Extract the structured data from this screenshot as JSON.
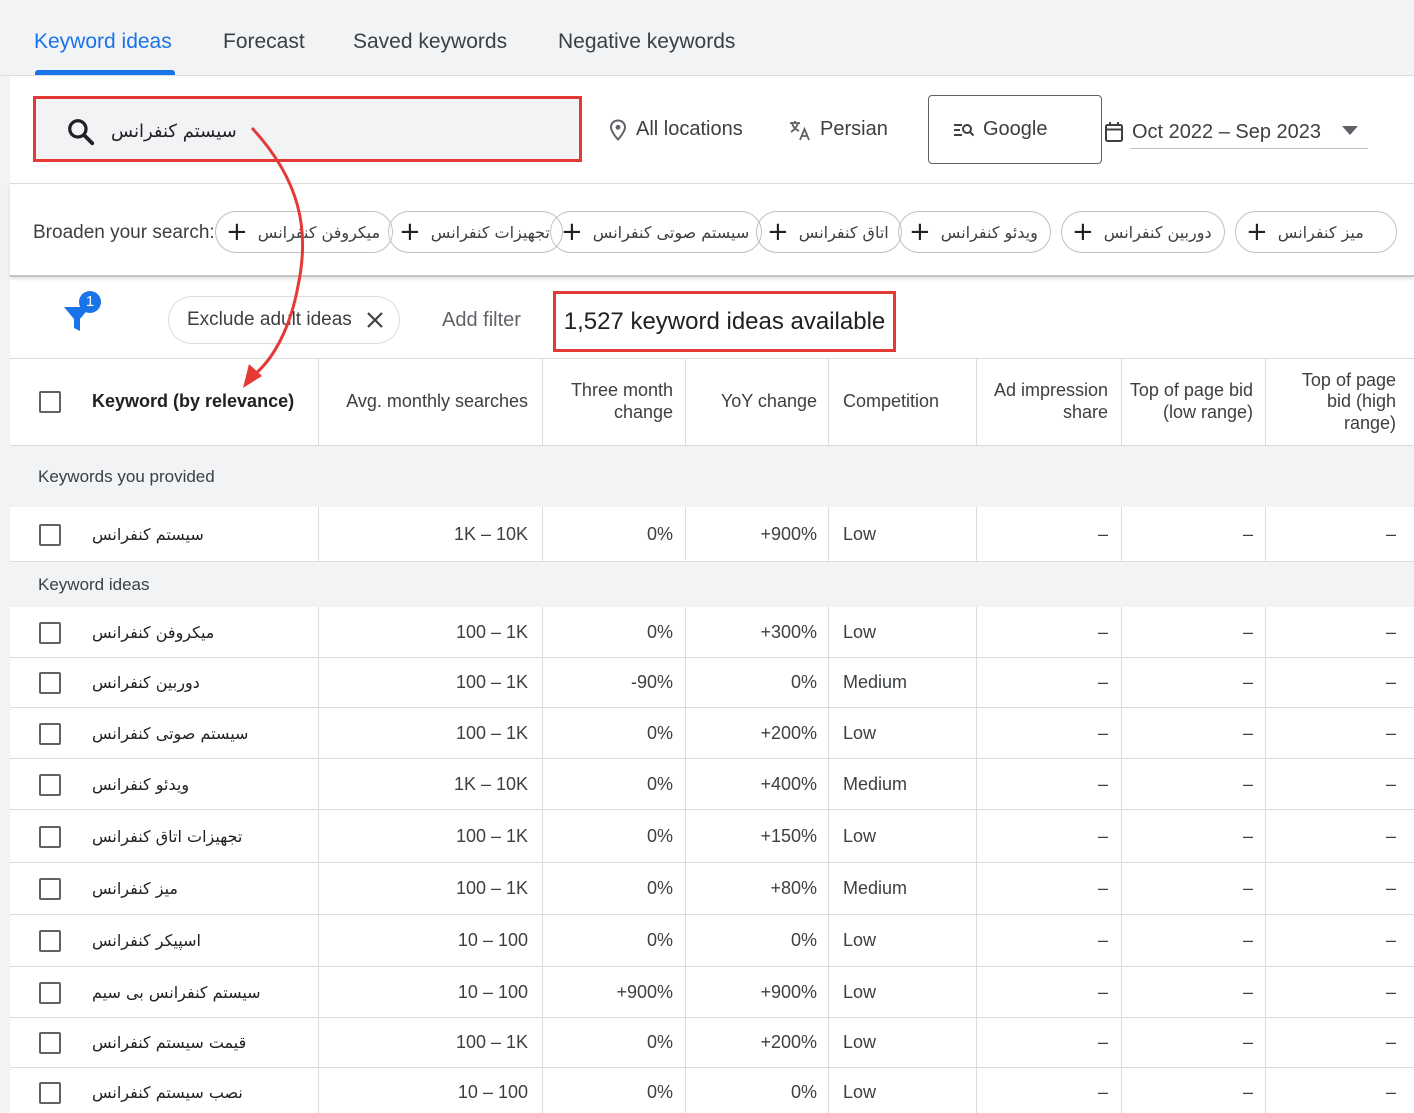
{
  "tabs": [
    {
      "label": "Keyword ideas",
      "active": true
    },
    {
      "label": "Forecast",
      "active": false
    },
    {
      "label": "Saved keywords",
      "active": false
    },
    {
      "label": "Negative keywords",
      "active": false
    }
  ],
  "search": {
    "value": "سیستم کنفرانس",
    "icon": "search-icon"
  },
  "options": {
    "location": "All locations",
    "language": "Persian",
    "network": "Google",
    "date_range": "Oct 2022 – Sep 2023"
  },
  "broaden": {
    "label": "Broaden your search:",
    "chips": [
      "میکروفن کنفرانس",
      "تجهیزات کنفرانس",
      "سیستم صوتی کنفرانس",
      "اتاق کنفرانس",
      "ویدئو کنفرانس",
      "دوربین کنفرانس",
      "میز کنفرانس"
    ]
  },
  "filters": {
    "badge_count": "1",
    "exclude_label": "Exclude adult ideas",
    "add_filter": "Add filter",
    "count_text": "1,527 keyword ideas available"
  },
  "columns": {
    "keyword": "Keyword (by relevance)",
    "avg": "Avg. monthly searches",
    "three_month": "Three month change",
    "yoy": "YoY change",
    "competition": "Competition",
    "ad_share": "Ad impression share",
    "bid_low": "Top of page bid (low range)",
    "bid_high": "Top of page bid (high range)"
  },
  "groups": {
    "provided": "Keywords you provided",
    "ideas": "Keyword ideas"
  },
  "provided_rows": [
    {
      "keyword": "سیستم کنفرانس",
      "avg": "1K – 10K",
      "three": "0%",
      "yoy": "+900%",
      "comp": "Low",
      "share": "–",
      "low": "–",
      "high": "–"
    }
  ],
  "idea_rows": [
    {
      "keyword": "میکروفن کنفرانس",
      "avg": "100 – 1K",
      "three": "0%",
      "yoy": "+300%",
      "comp": "Low",
      "share": "–",
      "low": "–",
      "high": "–"
    },
    {
      "keyword": "دوربین کنفرانس",
      "avg": "100 – 1K",
      "three": "-90%",
      "yoy": "0%",
      "comp": "Medium",
      "share": "–",
      "low": "–",
      "high": "–"
    },
    {
      "keyword": "سیستم صوتی کنفرانس",
      "avg": "100 – 1K",
      "three": "0%",
      "yoy": "+200%",
      "comp": "Low",
      "share": "–",
      "low": "–",
      "high": "–"
    },
    {
      "keyword": "ویدئو کنفرانس",
      "avg": "1K – 10K",
      "three": "0%",
      "yoy": "+400%",
      "comp": "Medium",
      "share": "–",
      "low": "–",
      "high": "–"
    },
    {
      "keyword": "تجهیزات اتاق کنفرانس",
      "avg": "100 – 1K",
      "three": "0%",
      "yoy": "+150%",
      "comp": "Low",
      "share": "–",
      "low": "–",
      "high": "–"
    },
    {
      "keyword": "میز کنفرانس",
      "avg": "100 – 1K",
      "three": "0%",
      "yoy": "+80%",
      "comp": "Medium",
      "share": "–",
      "low": "–",
      "high": "–"
    },
    {
      "keyword": "اسپیکر کنفرانس",
      "avg": "10 – 100",
      "three": "0%",
      "yoy": "0%",
      "comp": "Low",
      "share": "–",
      "low": "–",
      "high": "–"
    },
    {
      "keyword": "سیستم کنفرانس بی سیم",
      "avg": "10 – 100",
      "three": "+900%",
      "yoy": "+900%",
      "comp": "Low",
      "share": "–",
      "low": "–",
      "high": "–"
    },
    {
      "keyword": "قیمت سیستم کنفرانس",
      "avg": "100 – 1K",
      "three": "0%",
      "yoy": "+200%",
      "comp": "Low",
      "share": "–",
      "low": "–",
      "high": "–"
    },
    {
      "keyword": "نصب سیستم کنفرانس",
      "avg": "10 – 100",
      "three": "0%",
      "yoy": "0%",
      "comp": "Low",
      "share": "–",
      "low": "–",
      "high": "–"
    }
  ],
  "colors": {
    "accent": "#1a73e8",
    "highlight": "#e53935",
    "background": "#f1f3f4"
  }
}
